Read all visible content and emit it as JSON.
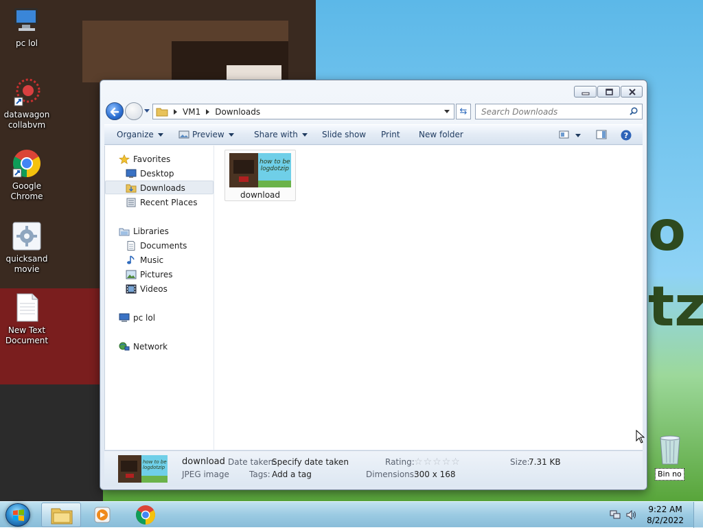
{
  "desktop": {
    "icons": [
      {
        "label_1": "pc lol",
        "label_2": "",
        "icon": "computer-icon"
      },
      {
        "label_1": "datawagon",
        "label_2": "collabvm",
        "icon": "datawagon-shortcut-icon"
      },
      {
        "label_1": "Google",
        "label_2": "Chrome",
        "icon": "chrome-icon"
      },
      {
        "label_1": "quicksand",
        "label_2": "movie",
        "icon": "movie-settings-icon"
      },
      {
        "label_1": "New Text",
        "label_2": "Document",
        "icon": "text-document-icon"
      }
    ],
    "recycle_bin_label": "Bin no"
  },
  "explorer": {
    "breadcrumb": [
      "VM1",
      "Downloads"
    ],
    "search_placeholder": "Search Downloads",
    "commands": {
      "organize": "Organize",
      "preview": "Preview",
      "share_with": "Share with",
      "slide_show": "Slide show",
      "print": "Print",
      "new_folder": "New folder"
    },
    "nav": {
      "favorites": "Favorites",
      "desktop": "Desktop",
      "downloads": "Downloads",
      "recent_places": "Recent Places",
      "libraries": "Libraries",
      "documents": "Documents",
      "music": "Music",
      "pictures": "Pictures",
      "videos": "Videos",
      "computer": "pc lol",
      "network": "Network"
    },
    "files": [
      {
        "name": "download",
        "thumb_text_1": "how to be",
        "thumb_text_2": "logdotzip"
      }
    ],
    "details": {
      "name": "download",
      "type": "JPEG image",
      "date_taken_label": "Date taken:",
      "date_taken_value": "Specify date taken",
      "tags_label": "Tags:",
      "tags_value": "Add a tag",
      "rating_label": "Rating:",
      "rating_stars": 0,
      "dimensions_label": "Dimensions:",
      "dimensions_value": "300 x 168",
      "size_label": "Size:",
      "size_value": "7.31 KB"
    }
  },
  "taskbar": {
    "time": "9:22 AM",
    "date": "8/2/2022"
  },
  "colors": {
    "accent": "#2c6fd1",
    "window_chrome": "#dfe8f3",
    "taskbar": "#96c8e1"
  }
}
